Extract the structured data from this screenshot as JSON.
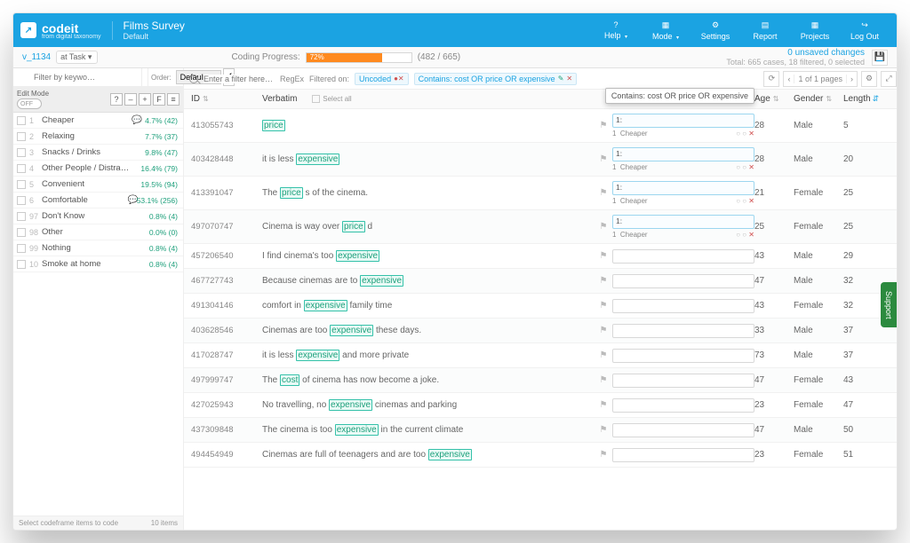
{
  "brand": {
    "name": "codeit",
    "tag": "from digital taxonomy"
  },
  "survey": {
    "title": "Films Survey",
    "subtitle": "Default"
  },
  "toolbar": [
    {
      "label": "Help",
      "caret": true,
      "icon": "help"
    },
    {
      "label": "Mode",
      "caret": true,
      "icon": "mode"
    },
    {
      "label": "Settings",
      "caret": false,
      "icon": "settings"
    },
    {
      "label": "Report",
      "caret": false,
      "icon": "report"
    },
    {
      "label": "Projects",
      "caret": false,
      "icon": "projects"
    },
    {
      "label": "Log Out",
      "caret": false,
      "icon": "logout"
    }
  ],
  "status": {
    "variable": "v_1134",
    "crumb": "at Task ▾",
    "progress_label": "Coding Progress:",
    "progress_pct": "72%",
    "progress_count": "(482 / 665)",
    "unsaved": "0 unsaved changes",
    "totals": "Total: 665 cases, 18 filtered, 0 selected"
  },
  "sidebar": {
    "filter_placeholder": "Filter by keywo…",
    "order_label": "Order:",
    "order_value": "Default",
    "edit_label": "Edit Mode",
    "switch": "OFF",
    "buttons": [
      "?",
      "–",
      "+",
      "F",
      "≡"
    ],
    "items": [
      {
        "n": "1",
        "name": "Cheaper",
        "bubble": true,
        "pct": "4.7% (42)"
      },
      {
        "n": "2",
        "name": "Relaxing",
        "bubble": false,
        "pct": "7.7% (37)"
      },
      {
        "n": "3",
        "name": "Snacks / Drinks",
        "bubble": false,
        "pct": "9.8% (47)"
      },
      {
        "n": "4",
        "name": "Other People / Distractions",
        "bubble": false,
        "pct": "16.4% (79)"
      },
      {
        "n": "5",
        "name": "Convenient",
        "bubble": false,
        "pct": "19.5% (94)"
      },
      {
        "n": "6",
        "name": "Comfortable",
        "bubble": true,
        "pct": "53.1% (256)"
      },
      {
        "n": "97",
        "name": "Don't Know",
        "bubble": false,
        "pct": "0.8% (4)"
      },
      {
        "n": "98",
        "name": "Other",
        "bubble": false,
        "pct": "0.0% (0)"
      },
      {
        "n": "99",
        "name": "Nothing",
        "bubble": false,
        "pct": "0.8% (4)"
      },
      {
        "n": "10",
        "name": "Smoke at home",
        "bubble": false,
        "pct": "0.8% (4)"
      }
    ],
    "foot_left": "Select codeframe items to code",
    "foot_right": "10 items"
  },
  "filterbar": {
    "placeholder": "Enter a filter here…",
    "regex": "RegEx",
    "filtered_on": "Filtered on:",
    "tag1": "Uncoded",
    "tag2": "Contains: cost OR price OR expensive",
    "page": "1 of 1 pages"
  },
  "tooltip": "Contains: cost OR price OR expensive",
  "grid": {
    "cols": {
      "id": "ID",
      "verbatim": "Verbatim",
      "selectall": "Select all",
      "age": "Age",
      "gender": "Gender",
      "length": "Length"
    },
    "cheaper": "Cheaper",
    "rows": [
      {
        "id": "413055743",
        "verb": [
          [
            "hl",
            "price"
          ]
        ],
        "code": "open",
        "age": "28",
        "gen": "Male",
        "len": "5"
      },
      {
        "id": "403428448",
        "verb": [
          [
            "t",
            "it is less "
          ],
          [
            "hl",
            "expensive"
          ]
        ],
        "code": "open",
        "age": "28",
        "gen": "Male",
        "len": "20"
      },
      {
        "id": "413391047",
        "verb": [
          [
            "t",
            "The "
          ],
          [
            "hl",
            "price"
          ],
          [
            "t",
            " s of the cinema."
          ]
        ],
        "code": "open",
        "age": "21",
        "gen": "Female",
        "len": "25"
      },
      {
        "id": "497070747",
        "verb": [
          [
            "t",
            "Cinema is way over "
          ],
          [
            "hl",
            "price"
          ],
          [
            "t",
            " d"
          ]
        ],
        "code": "focus",
        "age": "25",
        "gen": "Female",
        "len": "25"
      },
      {
        "id": "457206540",
        "verb": [
          [
            "t",
            "I find cinema's too "
          ],
          [
            "hl",
            "expensive"
          ]
        ],
        "code": "",
        "age": "43",
        "gen": "Male",
        "len": "29"
      },
      {
        "id": "467727743",
        "verb": [
          [
            "t",
            "Because cinemas are to "
          ],
          [
            "hl",
            "expensive"
          ]
        ],
        "code": "",
        "age": "47",
        "gen": "Male",
        "len": "32"
      },
      {
        "id": "491304146",
        "verb": [
          [
            "t",
            "comfort in "
          ],
          [
            "hl",
            "expensive"
          ],
          [
            "t",
            " family time"
          ]
        ],
        "code": "",
        "age": "43",
        "gen": "Female",
        "len": "32"
      },
      {
        "id": "403628546",
        "verb": [
          [
            "t",
            "Cinemas are too "
          ],
          [
            "hl",
            "expensive"
          ],
          [
            "t",
            " these days."
          ]
        ],
        "code": "",
        "age": "33",
        "gen": "Male",
        "len": "37"
      },
      {
        "id": "417028747",
        "verb": [
          [
            "t",
            "it is less "
          ],
          [
            "hl",
            "expensive"
          ],
          [
            "t",
            " and more private"
          ]
        ],
        "code": "",
        "age": "73",
        "gen": "Male",
        "len": "37"
      },
      {
        "id": "497999747",
        "verb": [
          [
            "t",
            "The "
          ],
          [
            "hl",
            "cost"
          ],
          [
            "t",
            " of cinema has now become a joke."
          ]
        ],
        "code": "",
        "age": "47",
        "gen": "Female",
        "len": "43"
      },
      {
        "id": "427025943",
        "verb": [
          [
            "t",
            "No travelling, no "
          ],
          [
            "hl",
            "expensive"
          ],
          [
            "t",
            " cinemas and parking"
          ]
        ],
        "code": "",
        "age": "23",
        "gen": "Female",
        "len": "47"
      },
      {
        "id": "437309848",
        "verb": [
          [
            "t",
            "The cinema is too "
          ],
          [
            "hl",
            "expensive"
          ],
          [
            "t",
            " in the current climate"
          ]
        ],
        "code": "",
        "age": "47",
        "gen": "Male",
        "len": "50"
      },
      {
        "id": "494454949",
        "verb": [
          [
            "t",
            "Cinemas are full of teenagers and are too "
          ],
          [
            "hl",
            "expensive"
          ]
        ],
        "code": "",
        "age": "23",
        "gen": "Female",
        "len": "51"
      }
    ]
  },
  "support": "Support"
}
